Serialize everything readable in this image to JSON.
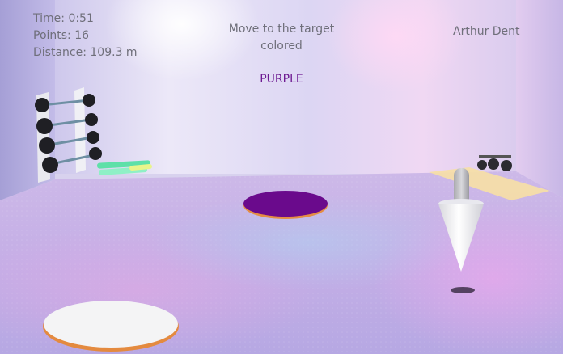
{
  "hud": {
    "time_label": "Time:",
    "time_value": "0:51",
    "points_label": "Points:",
    "points_value": "16",
    "distance_label": "Distance:",
    "distance_value": "109.3 m",
    "instruction": "Move to the target colored",
    "target_color_name": "PURPLE",
    "player_name": "Arthur Dent"
  },
  "colors": {
    "target_color": "#6e1b92",
    "hud_text": "#6f6f7a"
  },
  "scene": {
    "targets": [
      {
        "name": "purple-target-disc",
        "color": "#6a0a8c"
      },
      {
        "name": "white-target-disc",
        "color": "#f2f2f2"
      }
    ],
    "player_marker": "white-cone-marker"
  }
}
